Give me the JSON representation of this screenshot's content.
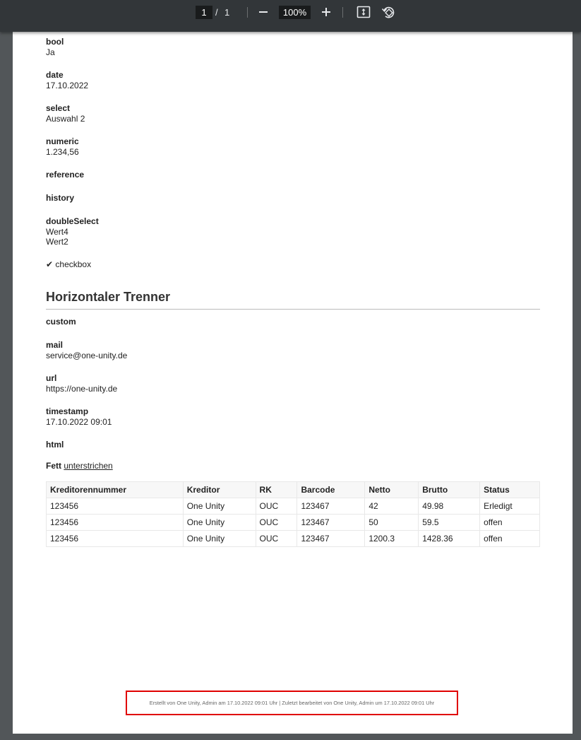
{
  "toolbar": {
    "page_current": "1",
    "page_separator": "/",
    "page_total": "1",
    "zoom": "100%",
    "icons": [
      "zoom-out-icon",
      "zoom-in-icon",
      "fit-page-icon",
      "rotate-icon"
    ]
  },
  "fields": [
    {
      "label": "bool",
      "value": "Ja"
    },
    {
      "label": "date",
      "value": "17.10.2022"
    },
    {
      "label": "select",
      "value": "Auswahl 2"
    },
    {
      "label": "numeric",
      "value": "1.234,56"
    },
    {
      "label": "reference",
      "value": ""
    },
    {
      "label": "history",
      "value": ""
    },
    {
      "label": "doubleSelect",
      "values": [
        "Wert4",
        "Wert2"
      ]
    }
  ],
  "checkbox": {
    "mark": "✔",
    "label": "checkbox"
  },
  "section": {
    "title": "Horizontaler Trenner"
  },
  "fields2": [
    {
      "label": "custom",
      "value": ""
    },
    {
      "label": "mail",
      "value": "service@one-unity.de"
    },
    {
      "label": "url",
      "value": "https://one-unity.de"
    },
    {
      "label": "timestamp",
      "value": "17.10.2022 09:01"
    },
    {
      "label": "html",
      "value": ""
    }
  ],
  "html_content": {
    "bold": "Fett",
    "underline": "unterstrichen"
  },
  "table": {
    "headers": [
      "Kreditorennummer",
      "Kreditor",
      "RK",
      "Barcode",
      "Netto",
      "Brutto",
      "Status"
    ],
    "rows": [
      [
        "123456",
        "One Unity",
        "OUC",
        "123467",
        "42",
        "49.98",
        "Erledigt"
      ],
      [
        "123456",
        "One Unity",
        "OUC",
        "123467",
        "50",
        "59.5",
        "offen"
      ],
      [
        "123456",
        "One Unity",
        "OUC",
        "123467",
        "1200.3",
        "1428.36",
        "offen"
      ]
    ]
  },
  "footer": {
    "text": "Erstellt von One Unity, Admin am 17.10.2022 09:01 Uhr | Zuletzt bearbeitet von One Unity, Admin um 17.10.2022 09:01 Uhr"
  },
  "colors": {
    "toolbar_bg": "#323639",
    "viewer_bg": "#525659",
    "highlight_border": "#e00000"
  }
}
